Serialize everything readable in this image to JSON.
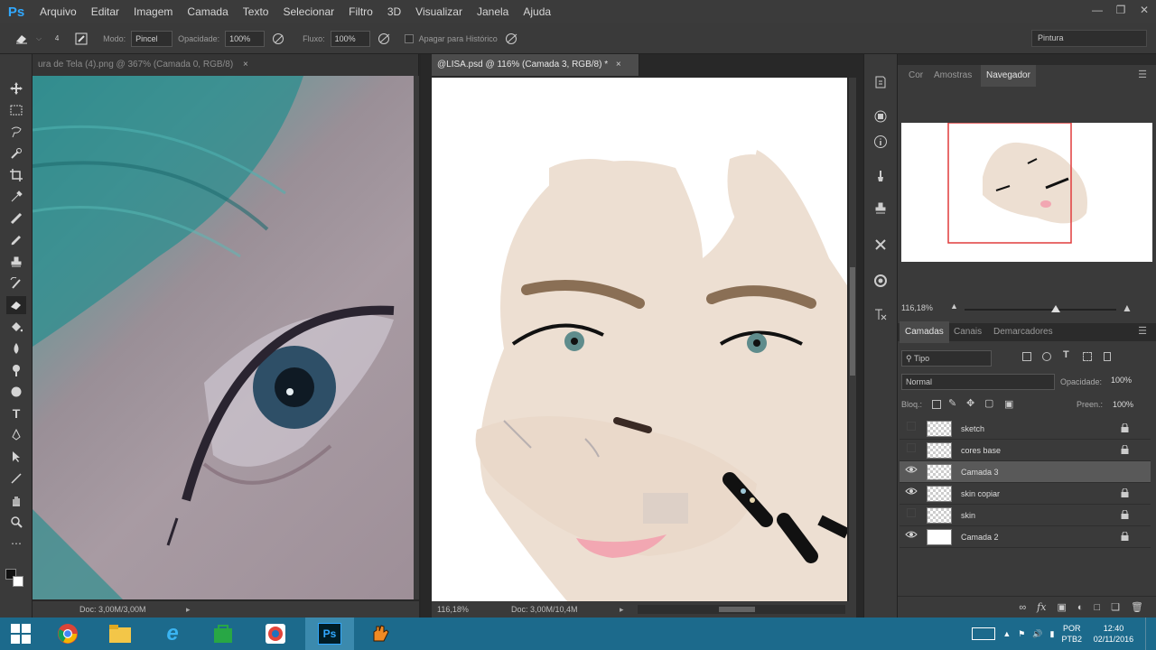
{
  "app": {
    "logo": "Ps"
  },
  "menu": [
    "Arquivo",
    "Editar",
    "Imagem",
    "Camada",
    "Texto",
    "Selecionar",
    "Filtro",
    "3D",
    "Visualizar",
    "Janela",
    "Ajuda"
  ],
  "options": {
    "mode_label": "Modo:",
    "mode_value": "Pincel",
    "opacity_label": "Opacidade:",
    "opacity_value": "100%",
    "flow_label": "Fluxo:",
    "flow_value": "100%",
    "history_label": "Apagar para Histórico",
    "brush_size": "4",
    "workspace": "Pintura"
  },
  "documents": [
    {
      "tab": "ura de Tela (4).png @ 367% (Camada 0, RGB/8)",
      "close": "×",
      "status_doc": "Doc: 3,00M/3,00M"
    },
    {
      "tab": "@LISA.psd @ 116% (Camada 3, RGB/8) *",
      "close": "×",
      "zoom": "116,18%",
      "status_doc": "Doc: 3,00M/10,4M"
    }
  ],
  "navigator": {
    "tabs": [
      "Cor",
      "Amostras",
      "Navegador"
    ],
    "zoom": "116,18%",
    "slider_fraction": 0.6
  },
  "layers_panel": {
    "tabs": [
      "Camadas",
      "Canais",
      "Demarcadores"
    ],
    "filter_label": "Tipo",
    "blend_mode": "Normal",
    "opacity_label": "Opacidade:",
    "opacity_value": "100%",
    "lock_label": "Bloq.:",
    "fill_label": "Preen.:",
    "fill_value": "100%",
    "layers": [
      {
        "name": "sketch",
        "visible": false,
        "locked": true,
        "selected": false
      },
      {
        "name": "cores base",
        "visible": false,
        "locked": true,
        "selected": false
      },
      {
        "name": "Camada 3",
        "visible": true,
        "locked": false,
        "selected": true
      },
      {
        "name": "skin copiar",
        "visible": true,
        "locked": true,
        "selected": false
      },
      {
        "name": "skin",
        "visible": false,
        "locked": true,
        "selected": false
      },
      {
        "name": "Camada 2",
        "visible": true,
        "locked": true,
        "selected": false,
        "white": true
      }
    ]
  },
  "taskbar": {
    "lang_top": "POR",
    "lang_bottom": "PTB2",
    "time": "12:40",
    "date": "02/11/2016"
  }
}
